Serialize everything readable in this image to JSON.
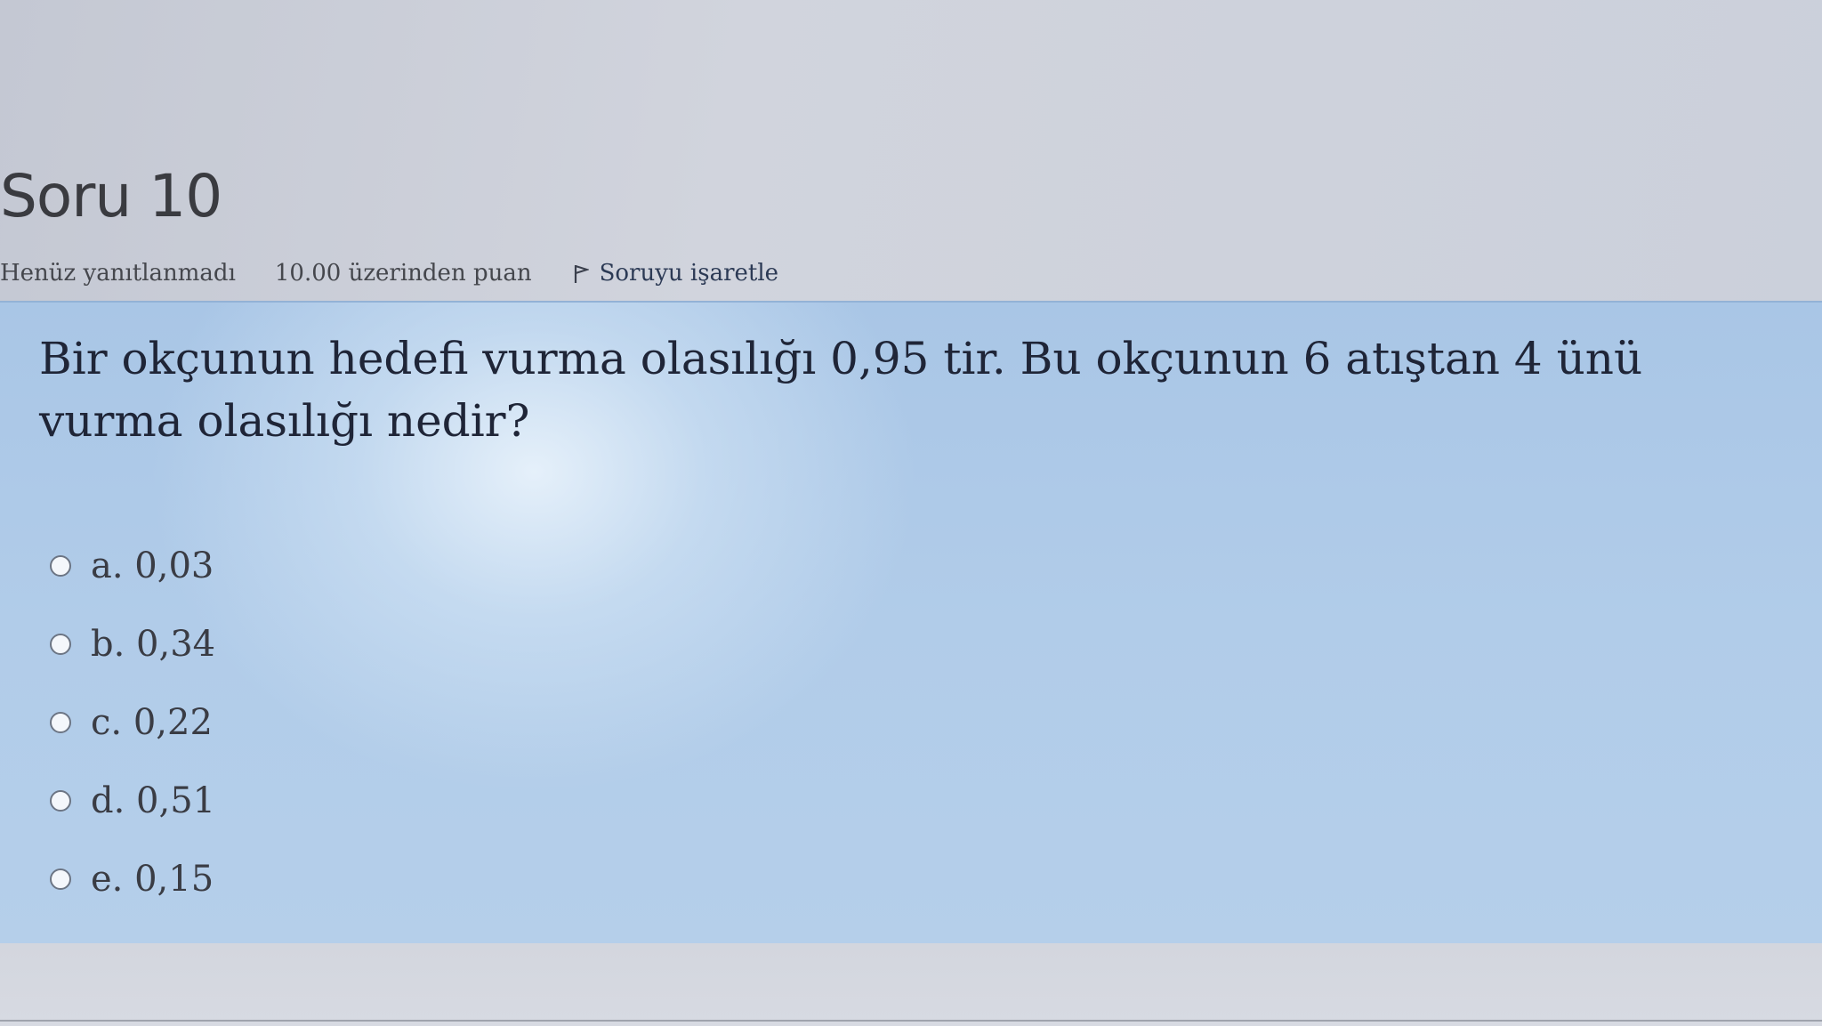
{
  "question": {
    "title": "Soru 10",
    "state": "Henüz yanıtlanmadı",
    "grade": "10.00 üzerinden puan",
    "flag_label": "Soruyu işaretle",
    "text": "Bir okçunun hedefi vurma olasılığı 0,95 tir. Bu okçunun 6 atıştan 4 ünü vurma olasılığı nedir?"
  },
  "answers": [
    {
      "letter": "a.",
      "value": "0,03",
      "label": "a. 0,03"
    },
    {
      "letter": "b.",
      "value": "0,34",
      "label": "b. 0,34"
    },
    {
      "letter": "c.",
      "value": "0,22",
      "label": "c. 0,22"
    },
    {
      "letter": "d.",
      "value": "0,51",
      "label": "d. 0,51"
    },
    {
      "letter": "e.",
      "value": "0,15",
      "label": "e. 0,15"
    }
  ],
  "icons": {
    "flag": "flag-icon",
    "radio": "radio-button"
  },
  "colors": {
    "panel_background": "#b1cce9",
    "page_background": "#d3d6df",
    "title_text": "#3a3b40",
    "question_text": "#1f2537"
  }
}
